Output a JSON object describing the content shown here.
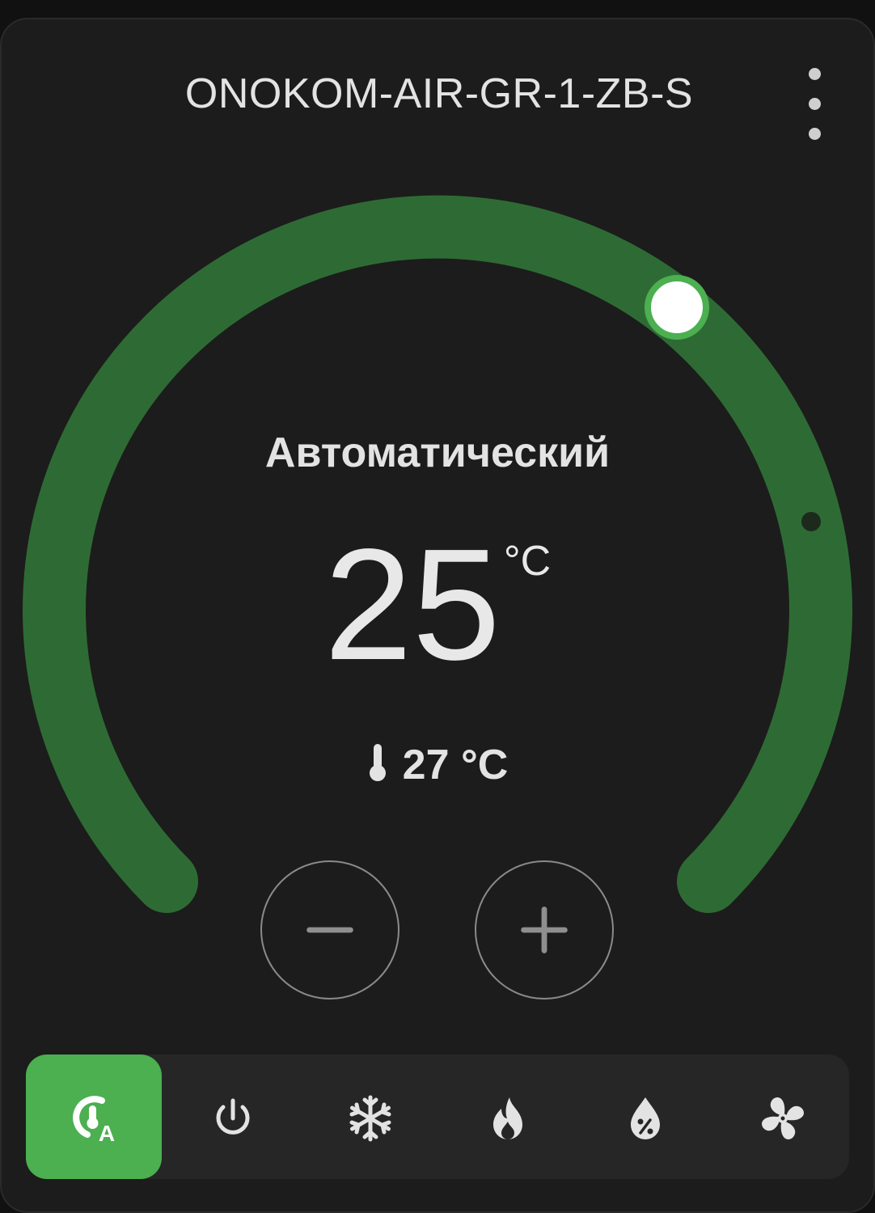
{
  "header": {
    "title": "ONOKOM-AIR-GR-1-ZB-S",
    "menu_icon": "dots-vertical-icon"
  },
  "dial": {
    "mode_label": "Автоматический",
    "target_temperature": "25",
    "target_unit": "°C",
    "current_temperature": "27 °C",
    "current_icon": "thermometer-icon",
    "arc_color": "#2e6b34",
    "handle_color": "#ffffff",
    "handle_ring_color": "#4caf50"
  },
  "controls": {
    "decrease": "−",
    "increase": "+"
  },
  "modes": [
    {
      "name": "auto",
      "icon": "thermostat-auto-icon",
      "active": true
    },
    {
      "name": "off",
      "icon": "power-icon",
      "active": false
    },
    {
      "name": "cool",
      "icon": "snowflake-icon",
      "active": false
    },
    {
      "name": "heat",
      "icon": "fire-icon",
      "active": false
    },
    {
      "name": "dry",
      "icon": "water-percent-icon",
      "active": false
    },
    {
      "name": "fan_only",
      "icon": "fan-icon",
      "active": false
    }
  ],
  "colors": {
    "active_mode_bg": "#4caf50",
    "card_bg": "#1c1c1c"
  }
}
